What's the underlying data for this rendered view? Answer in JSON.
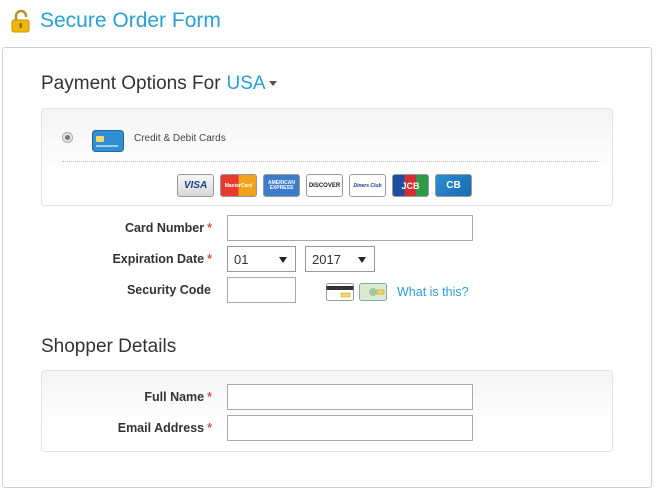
{
  "header": {
    "title": "Secure Order Form",
    "icon": "lock-icon"
  },
  "payment": {
    "heading": "Payment Options For",
    "country": "USA",
    "method_label": "Credit & Debit Cards",
    "brands": [
      "VISA",
      "MasterCard",
      "AMERICAN EXPRESS",
      "DISCOVER",
      "Diners Club",
      "JCB",
      "CB"
    ]
  },
  "form": {
    "card_number_label": "Card Number",
    "expiration_label": "Expiration Date",
    "security_label": "Security Code",
    "required_mark": "*",
    "exp_month": "01",
    "exp_year": "2017",
    "help_link": "What is this?"
  },
  "shopper": {
    "heading": "Shopper Details",
    "full_name_label": "Full Name",
    "email_label": "Email Address",
    "required_mark": "*"
  },
  "colors": {
    "accent": "#2a9fd6",
    "required": "#d9534f"
  }
}
